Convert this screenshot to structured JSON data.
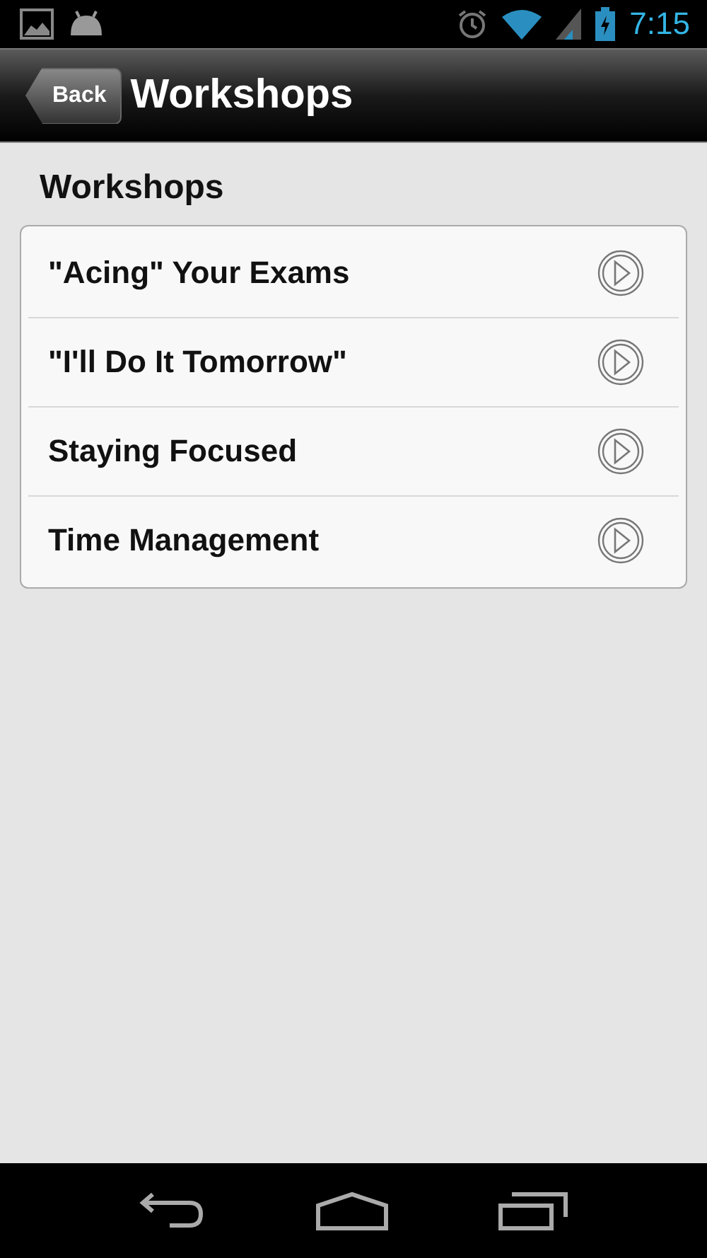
{
  "status_bar": {
    "time": "7:15"
  },
  "header": {
    "back_button": "Back",
    "title": "Workshops"
  },
  "section": {
    "title": "Workshops"
  },
  "items": [
    {
      "label": "\"Acing\" Your Exams"
    },
    {
      "label": "\"I'll Do It Tomorrow\""
    },
    {
      "label": "Staying Focused"
    },
    {
      "label": "Time Management"
    }
  ]
}
